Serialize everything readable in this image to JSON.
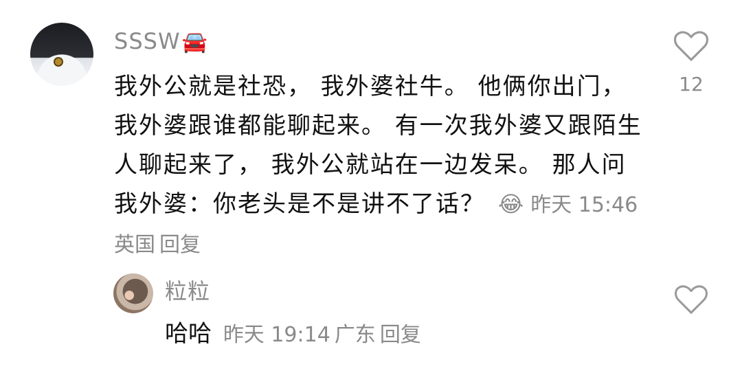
{
  "comment": {
    "username": "SSSW",
    "username_emoji": "🚘",
    "text": "我外公就是社恐， 我外婆社牛。 他俩你出门，我外婆跟谁都能聊起来。 有一次我外婆又跟陌生人聊起来了， 我外公就站在一边发呆。 那人问我外婆：你老头是不是讲不了话？",
    "emoji": "😂",
    "time": "昨天 15:46",
    "location": "英国",
    "reply_label": "回复",
    "like_count": "12"
  },
  "reply": {
    "username": "粒粒",
    "text": "哈哈",
    "time": "昨天 19:14",
    "location": "广东",
    "reply_label": "回复"
  },
  "colors": {
    "text": "#111111",
    "meta": "#8a8a8a",
    "icon": "#9a9a9a"
  }
}
